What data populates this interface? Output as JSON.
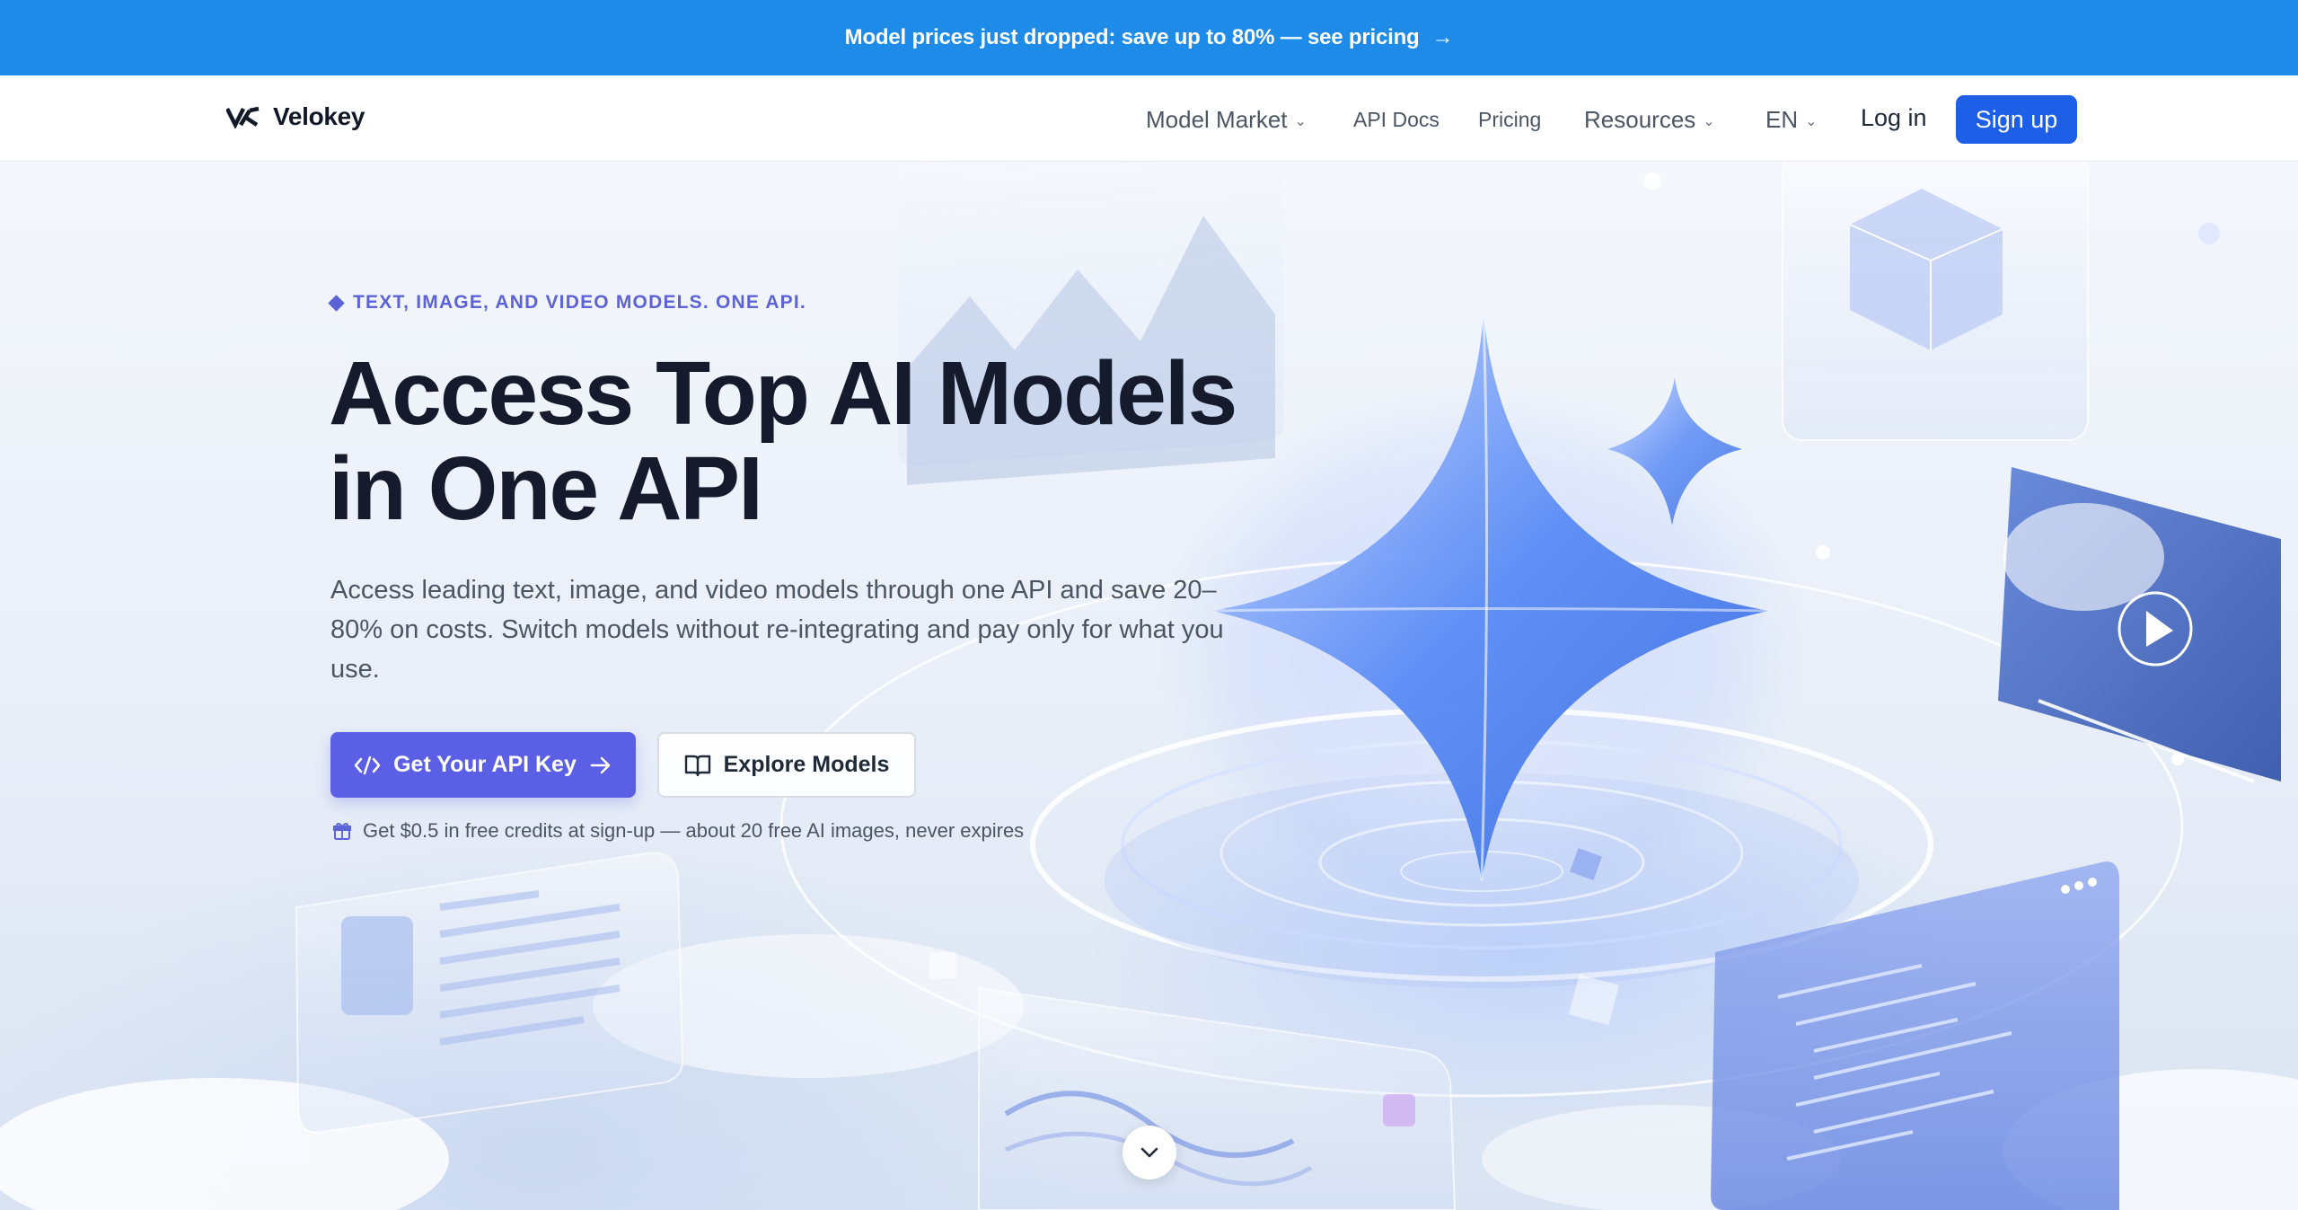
{
  "banner": {
    "text": "Model prices just dropped: save up to 80% — see pricing",
    "arrow_icon": "arrow-right-icon"
  },
  "nav": {
    "brand": "Velokey",
    "items": [
      {
        "label": "Model Market",
        "has_dropdown": true
      },
      {
        "label": "API Docs",
        "has_dropdown": false
      },
      {
        "label": "Pricing",
        "has_dropdown": false
      },
      {
        "label": "Resources",
        "has_dropdown": true
      },
      {
        "label": "EN",
        "has_dropdown": true
      }
    ],
    "login": "Log in",
    "signup": "Sign up"
  },
  "hero": {
    "eyebrow": "TEXT, IMAGE, AND VIDEO MODELS. ONE API.",
    "headline_line1": "Access Top AI Models",
    "headline_line2": "in One API",
    "subtitle": "Access leading text, image, and video models through one API and save 20–80% on costs. Switch models without re-integrating and pay only for what you use.",
    "primary_cta": "Get Your API Key",
    "secondary_cta": "Explore Models",
    "credits_note": "Get $0.5 in free credits at sign-up — about 20 free AI images, never expires"
  },
  "colors": {
    "banner_bg": "#1e8be9",
    "signup_bg": "#1d5fe6",
    "primary_cta_bg": "#5b5fe6",
    "eyebrow": "#5b63d6",
    "headline": "#151a2d"
  }
}
